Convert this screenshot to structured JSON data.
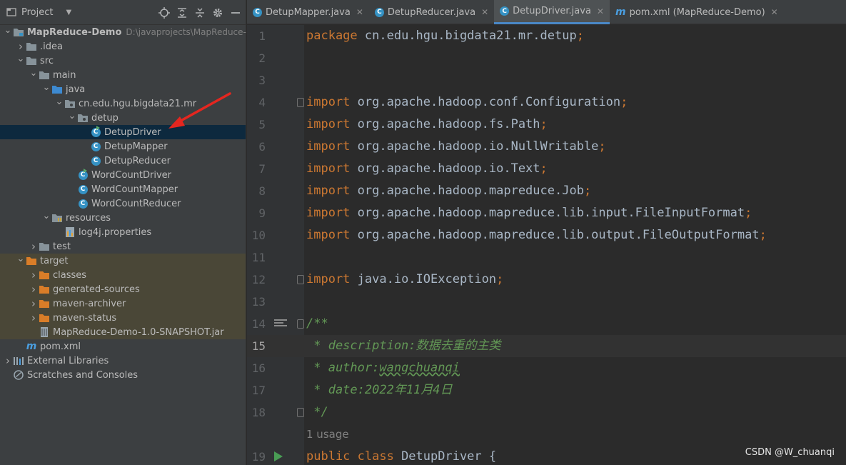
{
  "project_panel": {
    "title": "Project",
    "tree": [
      {
        "label": "MapReduce-Demo",
        "path": "D:\\javaprojects\\MapReduce-De",
        "depth": 0,
        "expanded": true,
        "icon": "module-folder-icon",
        "bold": true
      },
      {
        "label": ".idea",
        "depth": 1,
        "expanded": false,
        "icon": "folder-icon"
      },
      {
        "label": "src",
        "depth": 1,
        "expanded": true,
        "icon": "folder-icon"
      },
      {
        "label": "main",
        "depth": 2,
        "expanded": true,
        "icon": "folder-icon"
      },
      {
        "label": "java",
        "depth": 3,
        "expanded": true,
        "icon": "source-folder-icon"
      },
      {
        "label": "cn.edu.hgu.bigdata21.mr",
        "depth": 4,
        "expanded": true,
        "icon": "package-icon"
      },
      {
        "label": "detup",
        "depth": 5,
        "expanded": true,
        "icon": "package-icon"
      },
      {
        "label": "DetupDriver",
        "depth": 6,
        "icon": "class-run-icon",
        "selected": true
      },
      {
        "label": "DetupMapper",
        "depth": 6,
        "icon": "class-icon"
      },
      {
        "label": "DetupReducer",
        "depth": 6,
        "icon": "class-icon"
      },
      {
        "label": "WordCountDriver",
        "depth": 5,
        "icon": "class-run-icon"
      },
      {
        "label": "WordCountMapper",
        "depth": 5,
        "icon": "class-icon"
      },
      {
        "label": "WordCountReducer",
        "depth": 5,
        "icon": "class-icon"
      },
      {
        "label": "resources",
        "depth": 3,
        "expanded": true,
        "icon": "resources-folder-icon"
      },
      {
        "label": "log4j.properties",
        "depth": 4,
        "icon": "properties-file-icon"
      },
      {
        "label": "test",
        "depth": 2,
        "expanded": false,
        "icon": "folder-icon"
      },
      {
        "label": "target",
        "depth": 1,
        "expanded": true,
        "icon": "excluded-folder-icon",
        "excluded": true
      },
      {
        "label": "classes",
        "depth": 2,
        "expanded": false,
        "icon": "excluded-folder-icon",
        "excluded": true
      },
      {
        "label": "generated-sources",
        "depth": 2,
        "expanded": false,
        "icon": "excluded-folder-icon",
        "excluded": true
      },
      {
        "label": "maven-archiver",
        "depth": 2,
        "expanded": false,
        "icon": "excluded-folder-icon",
        "excluded": true
      },
      {
        "label": "maven-status",
        "depth": 2,
        "expanded": false,
        "icon": "excluded-folder-icon",
        "excluded": true
      },
      {
        "label": "MapReduce-Demo-1.0-SNAPSHOT.jar",
        "depth": 2,
        "icon": "jar-icon",
        "excluded": true
      },
      {
        "label": "pom.xml",
        "depth": 1,
        "icon": "maven-icon"
      },
      {
        "label": "External Libraries",
        "depth": 0,
        "expanded": false,
        "icon": "libraries-icon"
      },
      {
        "label": "Scratches and Consoles",
        "depth": 0,
        "icon": "scratches-icon"
      }
    ]
  },
  "tabs": [
    {
      "label": "DetupMapper.java",
      "icon": "class-icon",
      "active": false
    },
    {
      "label": "DetupReducer.java",
      "icon": "class-icon",
      "active": false
    },
    {
      "label": "DetupDriver.java",
      "icon": "class-run-icon",
      "active": true
    },
    {
      "label": "pom.xml (MapReduce-Demo)",
      "icon": "maven-icon",
      "active": false
    }
  ],
  "editor": {
    "current_line": "15",
    "lines": [
      {
        "n": "1",
        "parts": [
          [
            "kw",
            "package "
          ],
          [
            "p",
            "cn.edu.hgu.bigdata21.mr.detup"
          ],
          [
            "kw",
            ";"
          ]
        ]
      },
      {
        "n": "2",
        "parts": []
      },
      {
        "n": "3",
        "parts": []
      },
      {
        "n": "4",
        "parts": [
          [
            "kw",
            "import "
          ],
          [
            "p",
            "org.apache.hadoop.conf.Configuration"
          ],
          [
            "kw",
            ";"
          ]
        ]
      },
      {
        "n": "5",
        "parts": [
          [
            "kw",
            "import "
          ],
          [
            "p",
            "org.apache.hadoop.fs.Path"
          ],
          [
            "kw",
            ";"
          ]
        ]
      },
      {
        "n": "6",
        "parts": [
          [
            "kw",
            "import "
          ],
          [
            "p",
            "org.apache.hadoop.io.NullWritable"
          ],
          [
            "kw",
            ";"
          ]
        ]
      },
      {
        "n": "7",
        "parts": [
          [
            "kw",
            "import "
          ],
          [
            "p",
            "org.apache.hadoop.io.Text"
          ],
          [
            "kw",
            ";"
          ]
        ]
      },
      {
        "n": "8",
        "parts": [
          [
            "kw",
            "import "
          ],
          [
            "p",
            "org.apache.hadoop.mapreduce.Job"
          ],
          [
            "kw",
            ";"
          ]
        ]
      },
      {
        "n": "9",
        "parts": [
          [
            "kw",
            "import "
          ],
          [
            "p",
            "org.apache.hadoop.mapreduce.lib.input.FileInputFormat"
          ],
          [
            "kw",
            ";"
          ]
        ]
      },
      {
        "n": "10",
        "parts": [
          [
            "kw",
            "import "
          ],
          [
            "p",
            "org.apache.hadoop.mapreduce.lib.output.FileOutputFormat"
          ],
          [
            "kw",
            ";"
          ]
        ]
      },
      {
        "n": "11",
        "parts": []
      },
      {
        "n": "12",
        "parts": [
          [
            "kw",
            "import "
          ],
          [
            "p",
            "java.io.IOException"
          ],
          [
            "kw",
            ";"
          ]
        ]
      },
      {
        "n": "13",
        "parts": []
      },
      {
        "n": "14",
        "parts": [
          [
            "doc",
            "/**"
          ]
        ]
      },
      {
        "n": "15",
        "parts": [
          [
            "doc",
            " * description:数据去重的主类"
          ]
        ]
      },
      {
        "n": "16",
        "parts": [
          [
            "doc",
            " * author:"
          ],
          [
            "docw",
            "wangchuanqi"
          ]
        ]
      },
      {
        "n": "17",
        "parts": [
          [
            "doc",
            " * date:2022年11月4日"
          ]
        ]
      },
      {
        "n": "18",
        "parts": [
          [
            "doc",
            " */"
          ]
        ]
      },
      {
        "n": "",
        "parts": [
          [
            "hint",
            "1 usage"
          ]
        ]
      },
      {
        "n": "19",
        "parts": [
          [
            "kw",
            "public class "
          ],
          [
            "p",
            "DetupDriver {"
          ]
        ]
      }
    ]
  },
  "watermark": "CSDN @W_chuanqi",
  "colors": {
    "keyword": "#cc7832",
    "plain": "#a9b7c6",
    "doc": "#629755",
    "selection": "#0d293e",
    "excluded": "#4a4737",
    "accent": "#4a88c7"
  }
}
